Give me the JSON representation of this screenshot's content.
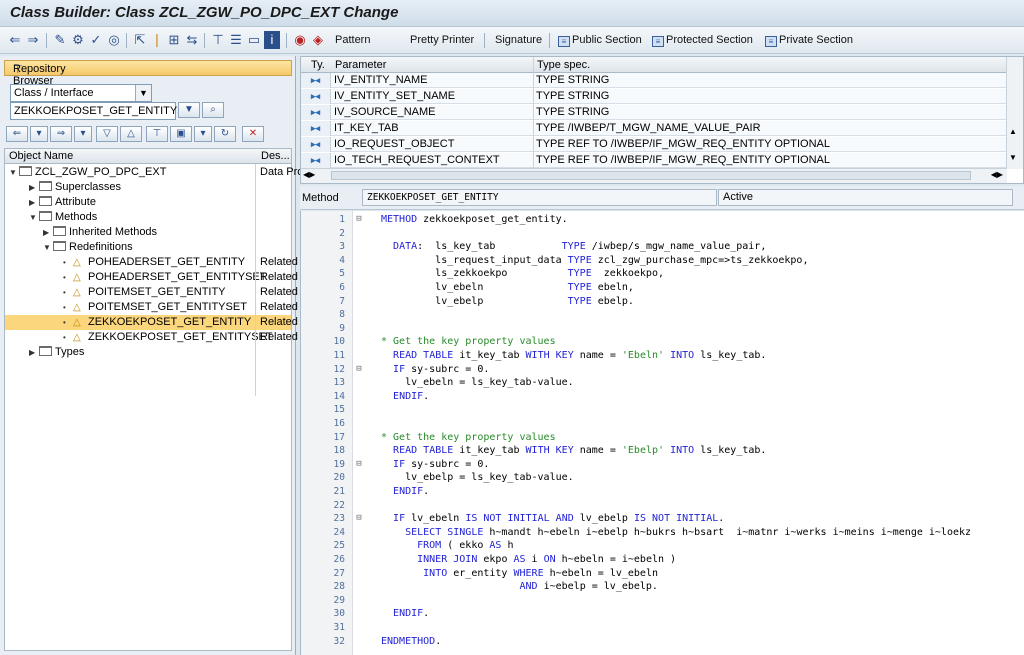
{
  "window": {
    "title": "Class Builder: Class ZCL_ZGW_PO_DPC_EXT Change"
  },
  "toolbar": {
    "pattern": "Pattern",
    "pretty_printer": "Pretty Printer",
    "signature": "Signature",
    "public_section": "Public Section",
    "protected_section": "Protected Section",
    "private_section": "Private Section"
  },
  "left": {
    "repository_browser": "Repository Browser",
    "object_type": "Class / Interface",
    "object_name": "ZEKKOEKPOSET_GET_ENTITYSET",
    "tree_header": {
      "name": "Object Name",
      "desc": "Des..."
    },
    "tree": [
      {
        "label": "ZCL_ZGW_PO_DPC_EXT",
        "desc": "Data Pro"
      },
      {
        "label": "Superclasses",
        "desc": ""
      },
      {
        "label": "Attribute",
        "desc": ""
      },
      {
        "label": "Methods",
        "desc": ""
      },
      {
        "label": "Inherited Methods",
        "desc": ""
      },
      {
        "label": "Redefinitions",
        "desc": ""
      },
      {
        "label": "POHEADERSET_GET_ENTITY",
        "desc": "Related"
      },
      {
        "label": "POHEADERSET_GET_ENTITYSET",
        "desc": "Related"
      },
      {
        "label": "POITEMSET_GET_ENTITY",
        "desc": "Related"
      },
      {
        "label": "POITEMSET_GET_ENTITYSET",
        "desc": "Related"
      },
      {
        "label": "ZEKKOEKPOSET_GET_ENTITY",
        "desc": "Related"
      },
      {
        "label": "ZEKKOEKPOSET_GET_ENTITYSET",
        "desc": "Related"
      },
      {
        "label": "Types",
        "desc": ""
      }
    ]
  },
  "params": {
    "header": {
      "ty": "Ty.",
      "parameter": "Parameter",
      "type_spec": "Type spec."
    },
    "rows": [
      {
        "name": "IV_ENTITY_NAME",
        "spec": "TYPE STRING"
      },
      {
        "name": "IV_ENTITY_SET_NAME",
        "spec": "TYPE STRING"
      },
      {
        "name": "IV_SOURCE_NAME",
        "spec": "TYPE STRING"
      },
      {
        "name": "IT_KEY_TAB",
        "spec": "TYPE /IWBEP/T_MGW_NAME_VALUE_PAIR"
      },
      {
        "name": "IO_REQUEST_OBJECT",
        "spec": "TYPE REF TO /IWBEP/IF_MGW_REQ_ENTITY OPTIONAL"
      },
      {
        "name": "IO_TECH_REQUEST_CONTEXT",
        "spec": "TYPE REF TO /IWBEP/IF_MGW_REQ_ENTITY OPTIONAL"
      }
    ]
  },
  "method": {
    "label": "Method",
    "name": "ZEKKOEKPOSET_GET_ENTITY",
    "status": "Active"
  },
  "code": [
    {
      "n": "1",
      "fold": "⊟",
      "t": "METHOD zekkoekposet_get_entity."
    },
    {
      "n": "2",
      "fold": "",
      "t": ""
    },
    {
      "n": "3",
      "fold": "",
      "t": "  DATA:  ls_key_tab           TYPE /iwbep/s_mgw_name_value_pair,"
    },
    {
      "n": "4",
      "fold": "",
      "t": "         ls_request_input_data TYPE zcl_zgw_purchase_mpc=>ts_zekkoekpo,"
    },
    {
      "n": "5",
      "fold": "",
      "t": "         ls_zekkoekpo          TYPE  zekkoekpo,"
    },
    {
      "n": "6",
      "fold": "",
      "t": "         lv_ebeln              TYPE ebeln,"
    },
    {
      "n": "7",
      "fold": "",
      "t": "         lv_ebelp              TYPE ebelp."
    },
    {
      "n": "8",
      "fold": "",
      "t": ""
    },
    {
      "n": "9",
      "fold": "",
      "t": ""
    },
    {
      "n": "10",
      "fold": "",
      "t": "* Get the key property values"
    },
    {
      "n": "11",
      "fold": "",
      "t": "  READ TABLE it_key_tab WITH KEY name = 'Ebeln' INTO ls_key_tab."
    },
    {
      "n": "12",
      "fold": "⊟",
      "t": "  IF sy-subrc = 0."
    },
    {
      "n": "13",
      "fold": "",
      "t": "    lv_ebeln = ls_key_tab-value."
    },
    {
      "n": "14",
      "fold": "",
      "t": "  ENDIF."
    },
    {
      "n": "15",
      "fold": "",
      "t": ""
    },
    {
      "n": "16",
      "fold": "",
      "t": ""
    },
    {
      "n": "17",
      "fold": "",
      "t": "* Get the key property values"
    },
    {
      "n": "18",
      "fold": "",
      "t": "  READ TABLE it_key_tab WITH KEY name = 'Ebelp' INTO ls_key_tab."
    },
    {
      "n": "19",
      "fold": "⊟",
      "t": "  IF sy-subrc = 0."
    },
    {
      "n": "20",
      "fold": "",
      "t": "    lv_ebelp = ls_key_tab-value."
    },
    {
      "n": "21",
      "fold": "",
      "t": "  ENDIF."
    },
    {
      "n": "22",
      "fold": "",
      "t": ""
    },
    {
      "n": "23",
      "fold": "⊟",
      "t": "  IF lv_ebeln IS NOT INITIAL AND lv_ebelp IS NOT INITIAL."
    },
    {
      "n": "24",
      "fold": "",
      "t": "    SELECT SINGLE h~mandt h~ebeln i~ebelp h~bukrs h~bsart  i~matnr i~werks i~meins i~menge i~loekz"
    },
    {
      "n": "25",
      "fold": "",
      "t": "      FROM ( ekko AS h"
    },
    {
      "n": "26",
      "fold": "",
      "t": "      INNER JOIN ekpo AS i ON h~ebeln = i~ebeln )"
    },
    {
      "n": "27",
      "fold": "",
      "t": "       INTO er_entity WHERE h~ebeln = lv_ebeln"
    },
    {
      "n": "28",
      "fold": "",
      "t": "                       AND i~ebelp = lv_ebelp."
    },
    {
      "n": "29",
      "fold": "",
      "t": ""
    },
    {
      "n": "30",
      "fold": "",
      "t": "  ENDIF."
    },
    {
      "n": "31",
      "fold": "",
      "t": ""
    },
    {
      "n": "32",
      "fold": "",
      "t": "ENDMETHOD."
    }
  ]
}
